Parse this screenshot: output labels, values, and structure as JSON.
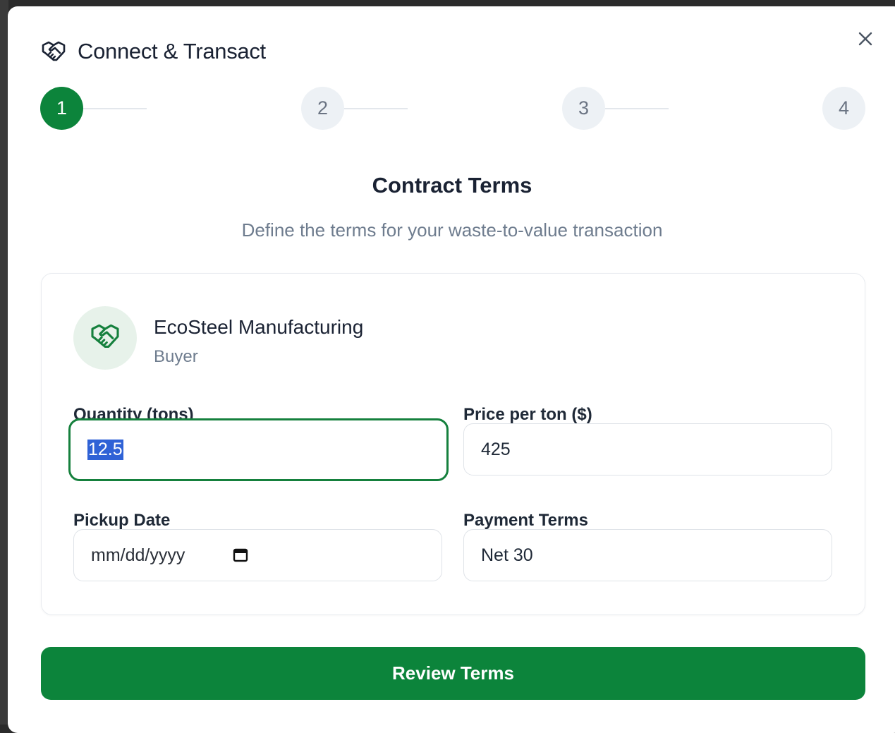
{
  "dialog": {
    "title": "Connect & Transact",
    "close_icon": "close-icon",
    "title_icon": "handshake-icon"
  },
  "stepper": {
    "steps": [
      {
        "label": "1",
        "state": "active"
      },
      {
        "label": "2",
        "state": "inactive"
      },
      {
        "label": "3",
        "state": "inactive"
      },
      {
        "label": "4",
        "state": "inactive"
      }
    ],
    "accent_color": "#0c843b"
  },
  "section": {
    "title": "Contract Terms",
    "subtitle": "Define the terms for your waste-to-value transaction"
  },
  "party": {
    "name": "EcoSteel Manufacturing",
    "role": "Buyer",
    "icon": "handshake-icon"
  },
  "form": {
    "quantity": {
      "label": "Quantity (tons)",
      "value": "12.5"
    },
    "price": {
      "label": "Price per ton ($)",
      "value": "425"
    },
    "pickup_date": {
      "label": "Pickup Date",
      "placeholder": "mm/dd/yyyy"
    },
    "payment_terms": {
      "label": "Payment Terms",
      "value": "Net 30"
    }
  },
  "actions": {
    "review_label": "Review Terms"
  }
}
